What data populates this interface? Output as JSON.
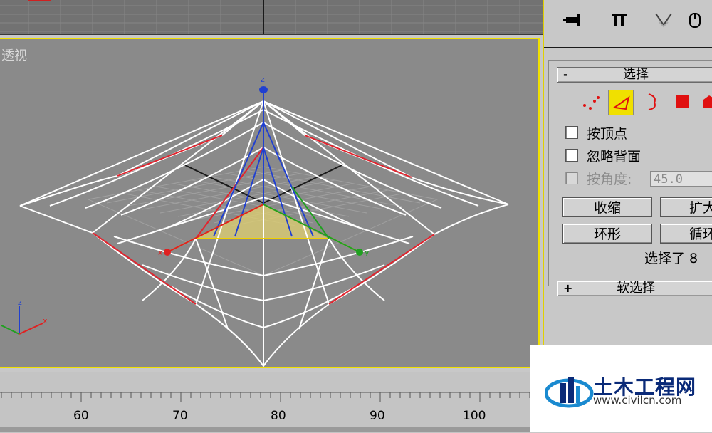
{
  "viewport": {
    "label": "透视"
  },
  "command_panel": {
    "toolbar_icons": [
      "pin-icon",
      "modifier-stack-icon",
      "vertex-weld-icon",
      "mouse-icon"
    ],
    "selection_rollout": {
      "sign": "-",
      "title": "选择",
      "sub_object_icons": [
        "vertex-mode-icon",
        "edge-mode-icon",
        "border-mode-icon",
        "polygon-mode-icon",
        "element-mode-icon"
      ],
      "active_sub_object": "edge",
      "by_vertex_label": "按顶点",
      "ignore_backfacing_label": "忽略背面",
      "by_angle_label": "按角度:",
      "by_angle_value": "45.0",
      "shrink_label": "收缩",
      "grow_label": "扩大",
      "ring_label": "环形",
      "loop_label": "循环",
      "status": "选择了 8"
    },
    "soft_selection_rollout": {
      "sign": "+",
      "title": "软选择"
    }
  },
  "timeline": {
    "tick_labels": [
      "60",
      "70",
      "80",
      "90",
      "100"
    ]
  },
  "watermark": {
    "brand": "土木工程网",
    "url": "www.civilcn.com"
  },
  "colors": {
    "selection_highlight": "#f0e000",
    "selected_edges": "#e2232d",
    "axis_x": "#e02020",
    "axis_y": "#20a020",
    "axis_z": "#2040d0"
  }
}
